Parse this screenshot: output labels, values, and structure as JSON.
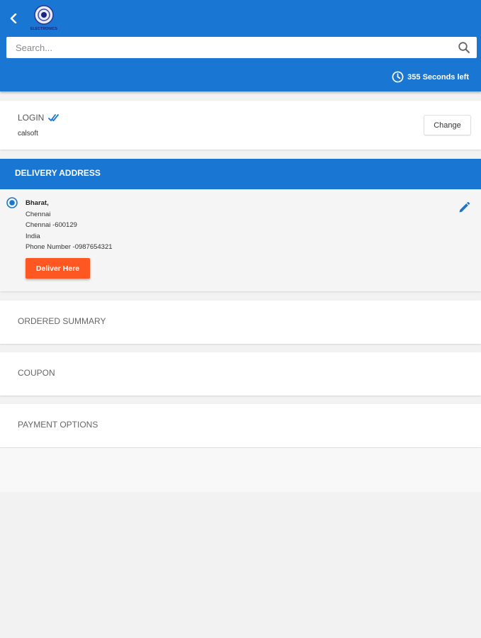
{
  "header": {
    "logo_text": "ELECTRONICS",
    "search_placeholder": "Search...",
    "timer_text": "355 Seconds left",
    "icons": {
      "back": "back-arrow-icon",
      "search": "search-icon",
      "timer": "timer-icon"
    }
  },
  "login": {
    "label": "LOGIN",
    "user": "calsoft",
    "change_label": "Change"
  },
  "delivery": {
    "title": "DELIVERY ADDRESS",
    "address": {
      "name": "Bharat,",
      "line1": "Chennai",
      "line2": "Chennai -600129",
      "country": "India",
      "phone": "Phone Number -0987654321"
    },
    "deliver_label": "Deliver Here"
  },
  "sections": {
    "ordered_summary": "ORDERED SUMMARY",
    "coupon": "COUPON",
    "payment_options": "PAYMENT OPTIONS"
  },
  "colors": {
    "primary": "#1976d2",
    "accent": "#ff5722",
    "background": "#f2f2f2"
  }
}
